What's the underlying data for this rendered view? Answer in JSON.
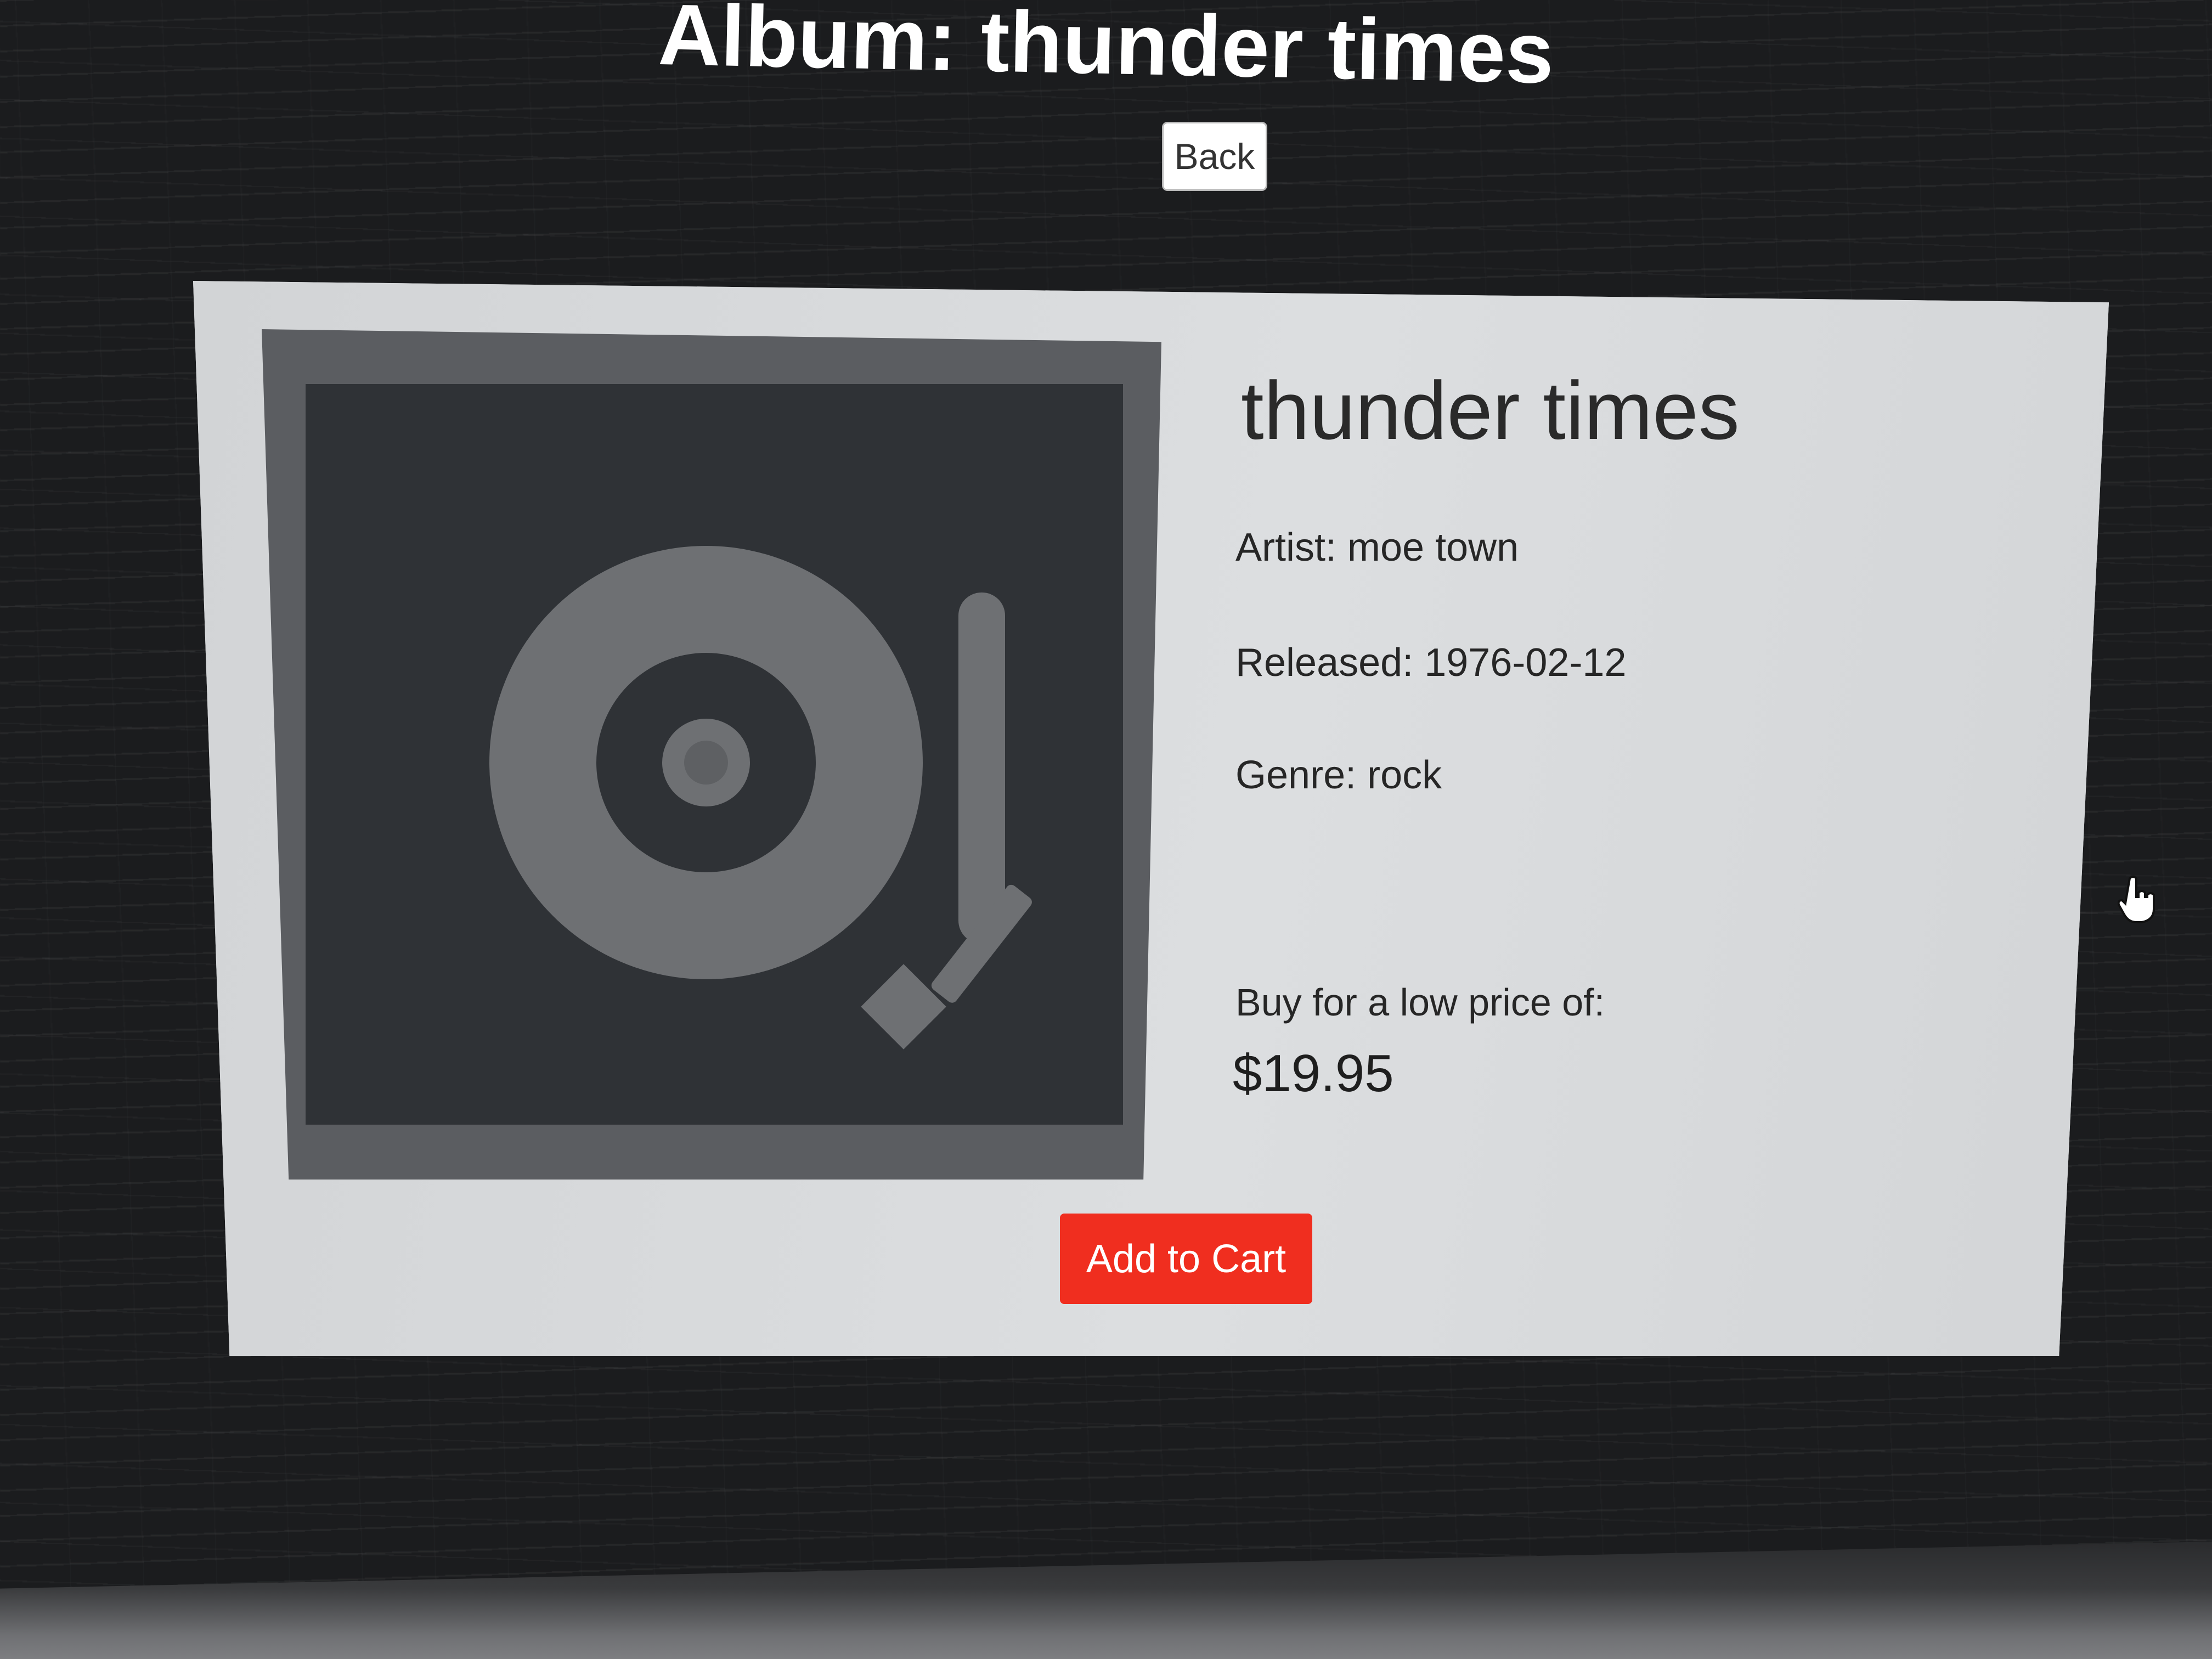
{
  "page": {
    "title": "Album: thunder times",
    "back_label": "Back"
  },
  "album": {
    "name": "thunder times",
    "artist": "Artist: moe town",
    "released": "Released: 1976-02-12",
    "genre": "Genre: rock",
    "buy_label": "Buy for a low price of:",
    "price": "$19.95",
    "add_to_cart_label": "Add to Cart",
    "cover_icon": "turntable-icon"
  },
  "colors": {
    "background": "#1b1c1e",
    "card": "#d6d8da",
    "cover_frame": "#5b5d61",
    "cover_inner": "#2f3236",
    "icon": "#6e7073",
    "add_to_cart_button": "#f02e1f"
  }
}
